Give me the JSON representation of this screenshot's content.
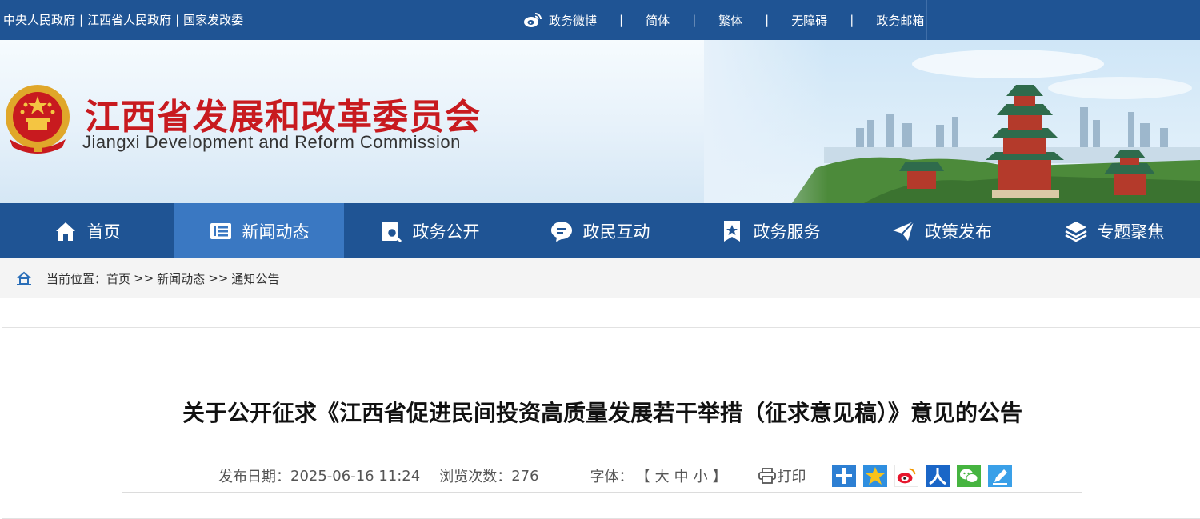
{
  "topbar": {
    "links": [
      "中央人民政府",
      "江西省人民政府",
      "国家发改委"
    ],
    "separator": "|",
    "weibo_label": "政务微博",
    "right_links": [
      "简体",
      "繁体",
      "无障碍",
      "政务邮箱"
    ],
    "right_separator": "|"
  },
  "banner": {
    "title_cn": "江西省发展和改革委员会",
    "title_en": "Jiangxi Development and Reform Commission"
  },
  "nav": {
    "items": [
      {
        "label": "首页",
        "icon": "home-icon"
      },
      {
        "label": "新闻动态",
        "icon": "news-icon"
      },
      {
        "label": "政务公开",
        "icon": "document-search-icon"
      },
      {
        "label": "政民互动",
        "icon": "chat-icon"
      },
      {
        "label": "政务服务",
        "icon": "bookmark-star-icon"
      },
      {
        "label": "政策发布",
        "icon": "send-icon"
      },
      {
        "label": "专题聚焦",
        "icon": "layers-icon"
      }
    ],
    "active_index": 1
  },
  "breadcrumb": {
    "prefix": "当前位置：",
    "items": [
      "首页",
      "新闻动态",
      "通知公告"
    ],
    "arrow": ">>"
  },
  "article": {
    "title": "关于公开征求《江西省促进民间投资高质量发展若干举措（征求意见稿）》意见的公告",
    "date_label": "发布日期：",
    "date": "2025-06-16 11:24",
    "views_label": "浏览次数：",
    "views": "276",
    "font_label": "字体：",
    "font_open": "【",
    "font_sizes": [
      "大",
      "中",
      "小"
    ],
    "font_close": "】",
    "print_label": "打印",
    "share_icons": [
      "share-plus-icon",
      "qzone-icon",
      "weibo-icon",
      "renren-icon",
      "wechat-icon",
      "pen-icon"
    ]
  },
  "colors": {
    "primary": "#1f5494",
    "nav_active": "#3a78c2",
    "title_red": "#c81a1f"
  }
}
